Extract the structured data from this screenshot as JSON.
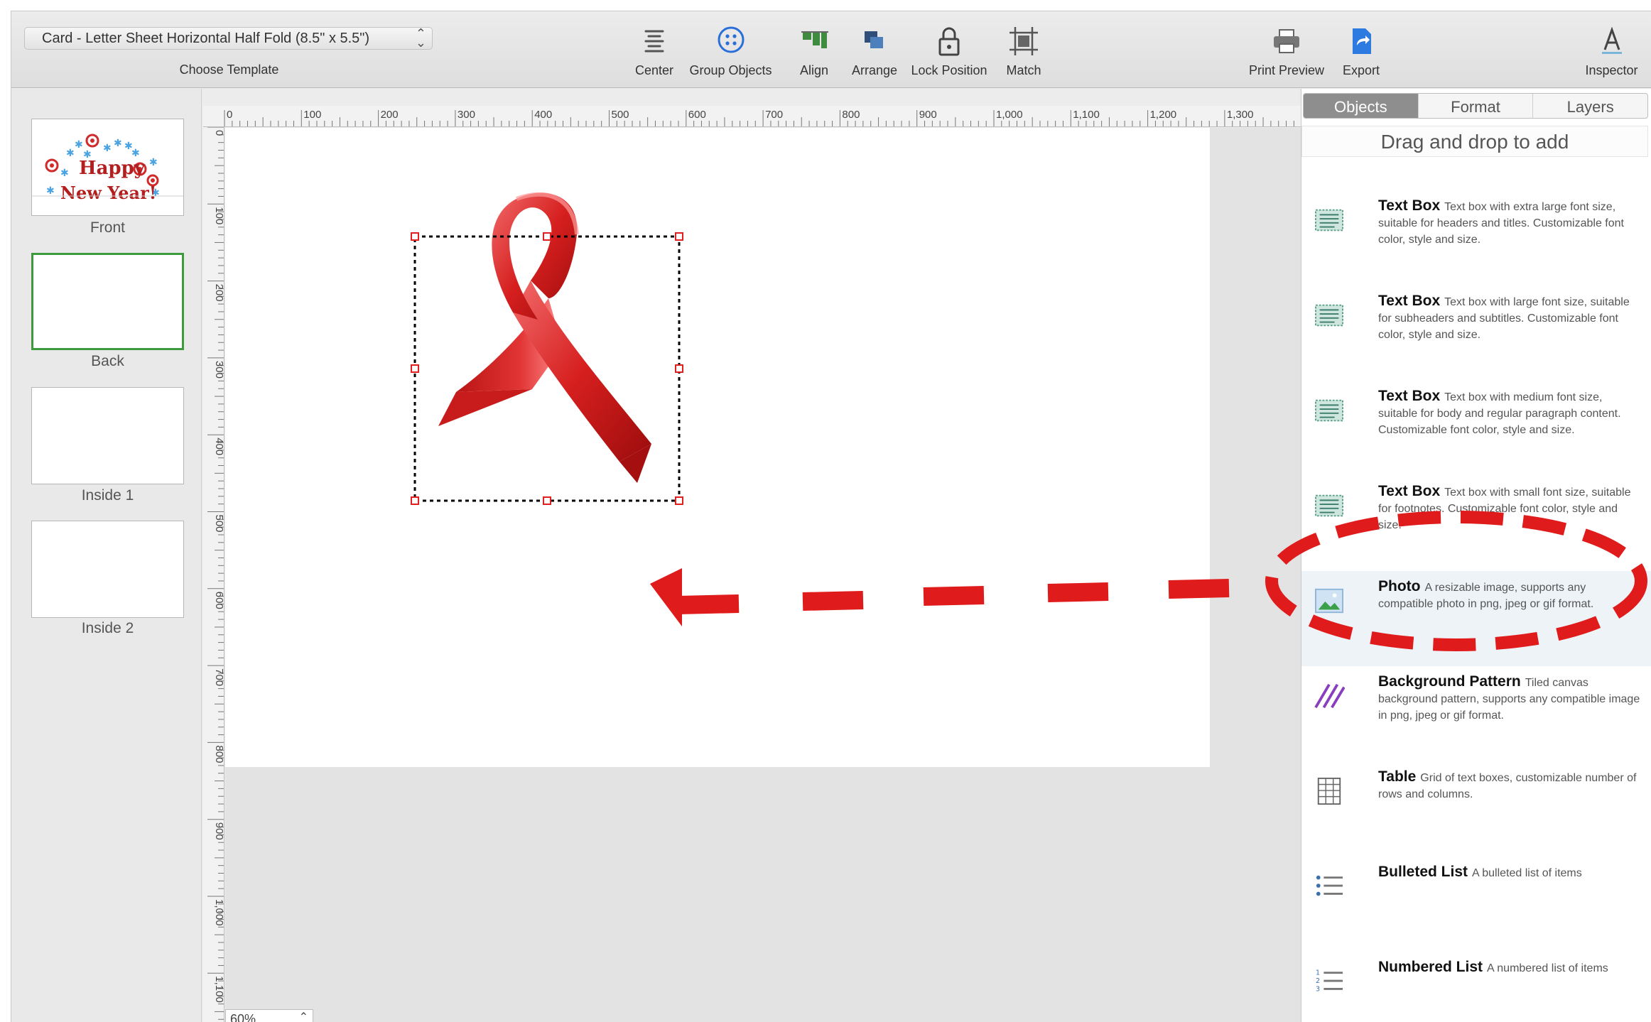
{
  "toolbar": {
    "template_value": "Card - Letter Sheet Horizontal Half Fold (8.5\" x 5.5\")",
    "template_caption": "Choose Template",
    "tools": {
      "center": "Center",
      "group": "Group Objects",
      "align": "Align",
      "arrange": "Arrange",
      "lock": "Lock Position",
      "match": "Match",
      "print": "Print Preview",
      "export": "Export",
      "inspector": "Inspector"
    }
  },
  "pages": {
    "front_label": "Front",
    "back_label": "Back",
    "inside1_label": "Inside 1",
    "inside2_label": "Inside 2",
    "front_art": {
      "line1": "Happy",
      "line2": "New Year!"
    }
  },
  "rulers": {
    "top": [
      "0",
      "100",
      "200",
      "300",
      "400",
      "500",
      "600",
      "700",
      "800",
      "900",
      "1,000",
      "1,100",
      "1,200",
      "1,300"
    ],
    "left": [
      "0",
      "100",
      "200",
      "300",
      "400",
      "500",
      "600",
      "700",
      "800",
      "900",
      "1,000",
      "1,100"
    ]
  },
  "zoom": "60%",
  "panel": {
    "tabs": {
      "objects": "Objects",
      "format": "Format",
      "layers": "Layers"
    },
    "hint": "Drag and drop to add",
    "items": [
      {
        "title": "Text Box",
        "desc": "Text box with extra large font size, suitable for headers and titles. Customizable font color, style and size.",
        "icon": "text-box-icon"
      },
      {
        "title": "Text Box",
        "desc": "Text box with large font size, suitable for subheaders and subtitles. Customizable font color, style and size.",
        "icon": "text-box-icon"
      },
      {
        "title": "Text Box",
        "desc": "Text box with medium font size, suitable for body and regular paragraph content. Customizable font color, style and size.",
        "icon": "text-box-icon"
      },
      {
        "title": "Text Box",
        "desc": "Text box with small font size, suitable for footnotes. Customizable font color, style and size.",
        "icon": "text-box-icon"
      },
      {
        "title": "Photo",
        "desc": "A resizable image, supports any compatible photo in png, jpeg or gif format.",
        "icon": "photo-icon"
      },
      {
        "title": "Background Pattern",
        "desc": "Tiled canvas background pattern, supports any compatible image in png, jpeg or gif format.",
        "icon": "pattern-icon"
      },
      {
        "title": "Table",
        "desc": "Grid of text boxes, customizable number of rows and columns.",
        "icon": "table-icon"
      },
      {
        "title": "Bulleted List",
        "desc": "A bulleted list of items",
        "icon": "bulleted-list-icon"
      },
      {
        "title": "Numbered List",
        "desc": "A numbered list of items",
        "icon": "numbered-list-icon"
      }
    ]
  },
  "colors": {
    "annotation_red": "#e01b1b",
    "selection_green": "#3d9a3d",
    "ribbon_red": "#d61f1f",
    "active_tab": "#8e8e8e"
  }
}
